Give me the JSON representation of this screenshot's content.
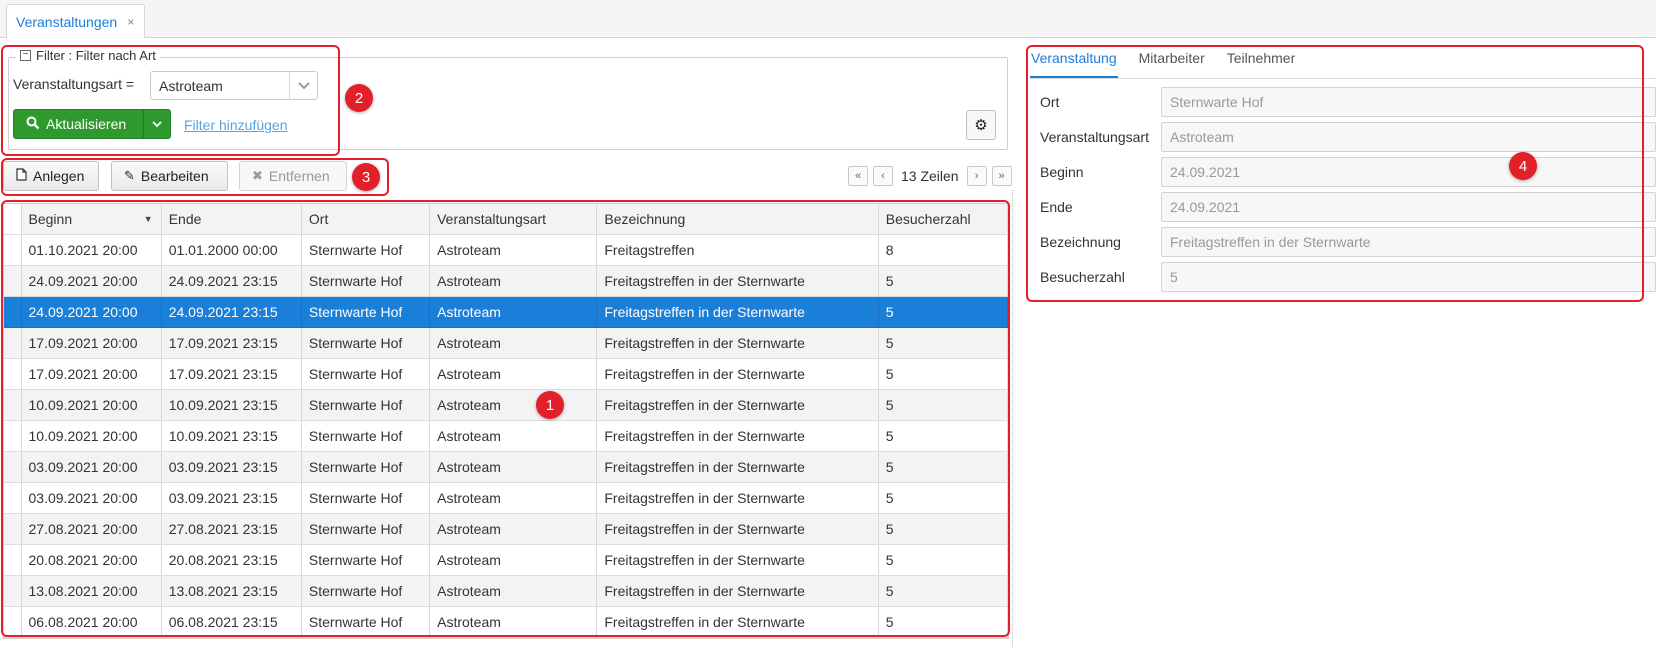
{
  "tabbar": {
    "tab_label": "Veranstaltungen",
    "close": "×"
  },
  "filter": {
    "legend": "Filter : Filter nach Art",
    "field_label": "Veranstaltungsart =",
    "selected": "Astroteam",
    "refresh_label": "Aktualisieren",
    "add_filter_label": "Filter hinzufügen"
  },
  "toolbar": {
    "create_label": "Anlegen",
    "edit_label": "Bearbeiten",
    "remove_label": "Entfernen",
    "row_count": "13 Zeilen"
  },
  "grid": {
    "columns": [
      "Beginn",
      "Ende",
      "Ort",
      "Veranstaltungsart",
      "Bezeichnung",
      "Besucherzahl"
    ],
    "selected_row": 2,
    "rows": [
      [
        "01.10.2021 20:00",
        "01.01.2000 00:00",
        "Sternwarte Hof",
        "Astroteam",
        "Freitagstreffen",
        "8"
      ],
      [
        "24.09.2021 20:00",
        "24.09.2021 23:15",
        "Sternwarte Hof",
        "Astroteam",
        "Freitagstreffen in der Sternwarte",
        "5"
      ],
      [
        "24.09.2021 20:00",
        "24.09.2021 23:15",
        "Sternwarte Hof",
        "Astroteam",
        "Freitagstreffen in der Sternwarte",
        "5"
      ],
      [
        "17.09.2021 20:00",
        "17.09.2021 23:15",
        "Sternwarte Hof",
        "Astroteam",
        "Freitagstreffen in der Sternwarte",
        "5"
      ],
      [
        "17.09.2021 20:00",
        "17.09.2021 23:15",
        "Sternwarte Hof",
        "Astroteam",
        "Freitagstreffen in der Sternwarte",
        "5"
      ],
      [
        "10.09.2021 20:00",
        "10.09.2021 23:15",
        "Sternwarte Hof",
        "Astroteam",
        "Freitagstreffen in der Sternwarte",
        "5"
      ],
      [
        "10.09.2021 20:00",
        "10.09.2021 23:15",
        "Sternwarte Hof",
        "Astroteam",
        "Freitagstreffen in der Sternwarte",
        "5"
      ],
      [
        "03.09.2021 20:00",
        "03.09.2021 23:15",
        "Sternwarte Hof",
        "Astroteam",
        "Freitagstreffen in der Sternwarte",
        "5"
      ],
      [
        "03.09.2021 20:00",
        "03.09.2021 23:15",
        "Sternwarte Hof",
        "Astroteam",
        "Freitagstreffen in der Sternwarte",
        "5"
      ],
      [
        "27.08.2021 20:00",
        "27.08.2021 23:15",
        "Sternwarte Hof",
        "Astroteam",
        "Freitagstreffen in der Sternwarte",
        "5"
      ],
      [
        "20.08.2021 20:00",
        "20.08.2021 23:15",
        "Sternwarte Hof",
        "Astroteam",
        "Freitagstreffen in der Sternwarte",
        "5"
      ],
      [
        "13.08.2021 20:00",
        "13.08.2021 23:15",
        "Sternwarte Hof",
        "Astroteam",
        "Freitagstreffen in der Sternwarte",
        "5"
      ],
      [
        "06.08.2021 20:00",
        "06.08.2021 23:15",
        "Sternwarte Hof",
        "Astroteam",
        "Freitagstreffen in der Sternwarte",
        "5"
      ]
    ]
  },
  "detail": {
    "tabs": [
      "Veranstaltung",
      "Mitarbeiter",
      "Teilnehmer"
    ],
    "fields": [
      {
        "label": "Ort",
        "value": "Sternwarte Hof"
      },
      {
        "label": "Veranstaltungsart",
        "value": "Astroteam"
      },
      {
        "label": "Beginn",
        "value": "24.09.2021"
      },
      {
        "label": "Ende",
        "value": "24.09.2021"
      },
      {
        "label": "Bezeichnung",
        "value": "Freitagstreffen in der Sternwarte"
      },
      {
        "label": "Besucherzahl",
        "value": "5"
      }
    ]
  },
  "annotations": [
    "1",
    "2",
    "3",
    "4"
  ],
  "colors": {
    "accent": "#1a7fd9",
    "primary_button": "#2e9a2e",
    "annotation": "#e3202a",
    "selected_row": "#1a7fd9"
  },
  "icons": {
    "search": "search-icon",
    "gear": "gear-icon",
    "file": "file-icon",
    "pencil": "pencil-icon",
    "remove": "x-icon"
  }
}
